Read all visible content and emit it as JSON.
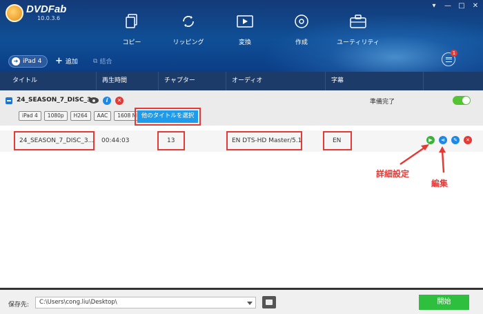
{
  "app": {
    "name": "DVDFab",
    "version": "10.0.3.6"
  },
  "window_controls": {
    "settings": "▾",
    "minimize": "—",
    "restore": "□",
    "close": "✕"
  },
  "nav": [
    {
      "label": "コピー",
      "icon": "copy-icon"
    },
    {
      "label": "リッピング",
      "icon": "ripper-icon"
    },
    {
      "label": "変換",
      "icon": "convert-icon"
    },
    {
      "label": "作成",
      "icon": "creator-icon"
    },
    {
      "label": "ユーティリティ",
      "icon": "utility-icon"
    }
  ],
  "toolbar": {
    "profile": "iPad 4",
    "add": "追加",
    "merge": "結合",
    "badge_count": "1"
  },
  "columns": [
    "タイトル",
    "再生時間",
    "チャプター",
    "オーディオ",
    "字幕"
  ],
  "group": {
    "title": "24_SEASON_7_DISC_3",
    "status": "準備完了",
    "tags": [
      "iPad 4",
      "1080p",
      "H264",
      "AAC",
      "1608 MB"
    ],
    "select_title_label": "他のタイトルを選択"
  },
  "row": {
    "title": "24_SEASON_7_DISC_3...",
    "duration": "00:44:03",
    "chapters": "13",
    "audio": "EN  DTS-HD Master/5.1",
    "subtitle": "EN"
  },
  "annotations": {
    "advanced": "詳細設定",
    "edit": "編集"
  },
  "footer": {
    "save_label": "保存先:",
    "path": "C:\\Users\\cong.liu\\Desktop\\",
    "start_label": "開始"
  },
  "colors": {
    "accent": "#1e9bea",
    "start": "#2fbf3f",
    "annotation": "#e53935",
    "header": "#1c3b69"
  }
}
